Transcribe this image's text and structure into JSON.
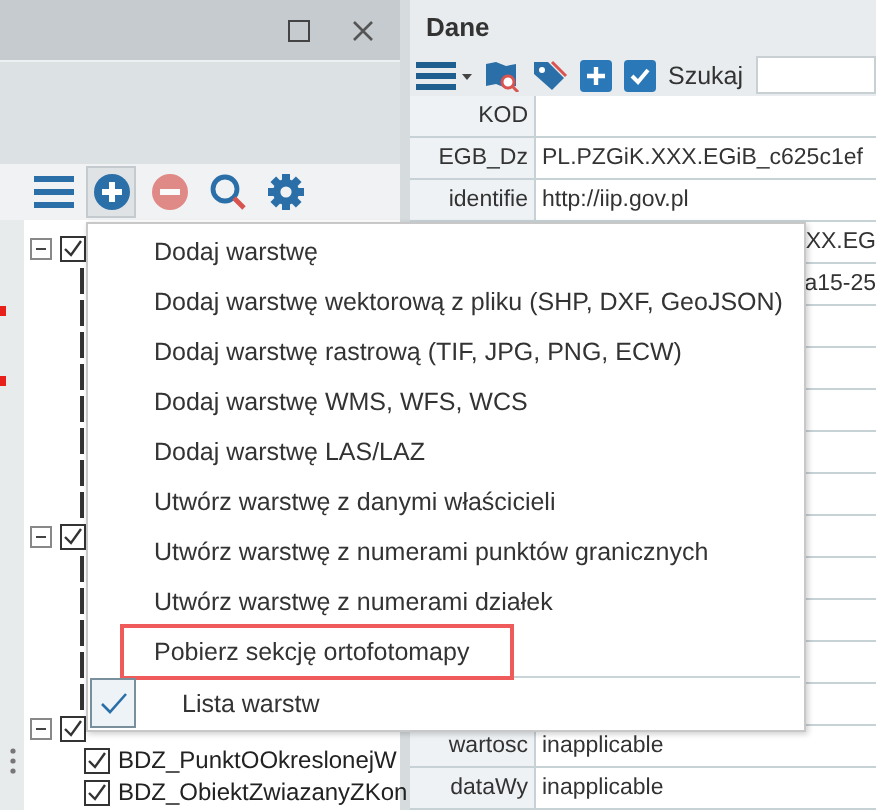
{
  "left_panel": {
    "toolbar": [
      {
        "kind": "menu",
        "selected": false,
        "disabled": false
      },
      {
        "kind": "add",
        "selected": true,
        "disabled": false
      },
      {
        "kind": "remove",
        "selected": false,
        "disabled": true
      },
      {
        "kind": "search",
        "selected": false,
        "disabled": false
      },
      {
        "kind": "settings",
        "selected": false,
        "disabled": false
      }
    ],
    "tree": [
      {
        "expanded": true,
        "checked": true,
        "children": [
          {
            "kind": "covered"
          },
          {
            "kind": "covered"
          },
          {
            "kind": "covered"
          },
          {
            "kind": "covered"
          },
          {
            "kind": "covered"
          },
          {
            "kind": "covered"
          },
          {
            "kind": "covered"
          },
          {
            "kind": "covered"
          }
        ]
      },
      {
        "expanded": true,
        "checked": true,
        "children": [
          {
            "kind": "covered"
          },
          {
            "kind": "covered"
          },
          {
            "kind": "covered"
          },
          {
            "kind": "covered"
          },
          {
            "kind": "covered"
          }
        ]
      },
      {
        "expanded": true,
        "checked": true,
        "children": [
          {
            "kind": "layer",
            "label": "BDZ_PunktOOkreslonejW",
            "checked": true
          },
          {
            "kind": "layer",
            "label": "BDZ_ObiektZwiazanyZKon",
            "checked": true
          }
        ]
      }
    ]
  },
  "data_panel": {
    "title": "Dane",
    "search_label": "Szukaj",
    "rows": [
      {
        "kind": "full",
        "key": "KOD"
      },
      {
        "kind": "full",
        "key": "EGB_Dz",
        "value": "PL.PZGiK.XXX.EGiB_c625c1ef"
      },
      {
        "kind": "full",
        "key": "identifie",
        "value": "http://iip.gov.pl"
      },
      {
        "kind": "partial",
        "value": "XX.EG"
      },
      {
        "kind": "partial",
        "value": "a15-25"
      },
      {
        "kind": "blank"
      },
      {
        "kind": "blank"
      },
      {
        "kind": "blank"
      },
      {
        "kind": "blank"
      },
      {
        "kind": "blank"
      },
      {
        "kind": "blank"
      },
      {
        "kind": "blank"
      },
      {
        "kind": "blank"
      },
      {
        "kind": "blank"
      },
      {
        "kind": "blank"
      },
      {
        "kind": "full",
        "key": "wartosc",
        "value": "inapplicable"
      },
      {
        "kind": "full",
        "key": "dataWy",
        "value": "inapplicable"
      }
    ]
  },
  "context_menu": {
    "items": [
      {
        "label": "Dodaj warstwę",
        "highlighted": false
      },
      {
        "label": "Dodaj warstwę wektorową z pliku (SHP, DXF, GeoJSON)",
        "highlighted": false
      },
      {
        "label": "Dodaj warstwę rastrową (TIF, JPG, PNG, ECW)",
        "highlighted": false
      },
      {
        "label": "Dodaj warstwę WMS, WFS, WCS",
        "highlighted": false
      },
      {
        "label": "Dodaj warstwę LAS/LAZ",
        "highlighted": false
      },
      {
        "label": "Utwórz warstwę z danymi właścicieli",
        "highlighted": false
      },
      {
        "label": "Utwórz warstwę z numerami punktów granicznych",
        "highlighted": false
      },
      {
        "label": "Utwórz warstwę z numerami działek",
        "highlighted": false
      },
      {
        "label": "Pobierz sekcję ortofotomapy",
        "highlighted": true
      }
    ],
    "footer": {
      "label": "Lista warstw",
      "checked": true
    }
  }
}
